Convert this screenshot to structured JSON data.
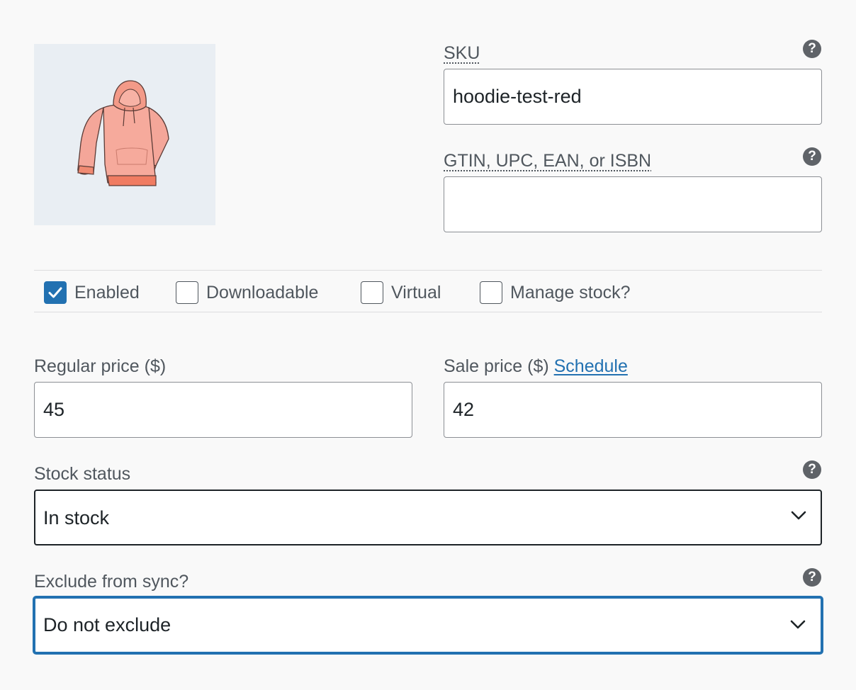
{
  "variation": {
    "image": {
      "icon": "hoodie-image",
      "alt": "Red hoodie"
    },
    "sku": {
      "label": "SKU",
      "value": "hoodie-test-red",
      "help_icon": "help-icon"
    },
    "gtin": {
      "label": "GTIN, UPC, EAN, or ISBN",
      "value": "",
      "help_icon": "help-icon"
    },
    "options": [
      {
        "label": "Enabled",
        "checked": true
      },
      {
        "label": "Downloadable",
        "checked": false
      },
      {
        "label": "Virtual",
        "checked": false
      },
      {
        "label": "Manage stock?",
        "checked": false
      }
    ],
    "regular_price": {
      "label": "Regular price ($)",
      "value": "45"
    },
    "sale_price": {
      "label": "Sale price ($)",
      "link": "Schedule",
      "value": "42"
    },
    "stock_status": {
      "label": "Stock status",
      "value": "In stock"
    },
    "exclude_sync": {
      "label": "Exclude from sync?",
      "value": "Do not exclude"
    }
  },
  "colors": {
    "accent": "#2271b1",
    "text": "#50575e",
    "border": "#8c8f94"
  }
}
